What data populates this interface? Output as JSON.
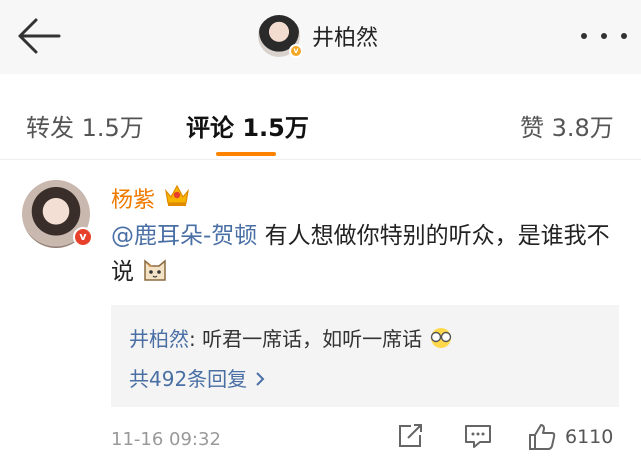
{
  "header": {
    "title": "井柏然",
    "back_icon": "arrow-left-icon",
    "more_icon": "more-dots-icon"
  },
  "tabs": [
    {
      "label": "转发 1.5万",
      "active": false
    },
    {
      "label": "评论 1.5万",
      "active": true
    },
    {
      "label": "赞 3.8万",
      "active": false
    }
  ],
  "comment": {
    "user": "杨紫",
    "mention": "@鹿耳朵-贺顿",
    "text": " 有人想做你特别的听众，是谁我不说",
    "reply": {
      "user": "井柏然",
      "separator": ": ",
      "text": "听君一席话，如听一席话"
    },
    "reply_more": "共492条回复 ",
    "time": "11-16 09:32",
    "likes": "6110"
  },
  "colors": {
    "accent": "#ff8200",
    "link": "#4a6fa5",
    "username": "#ef7a00"
  }
}
